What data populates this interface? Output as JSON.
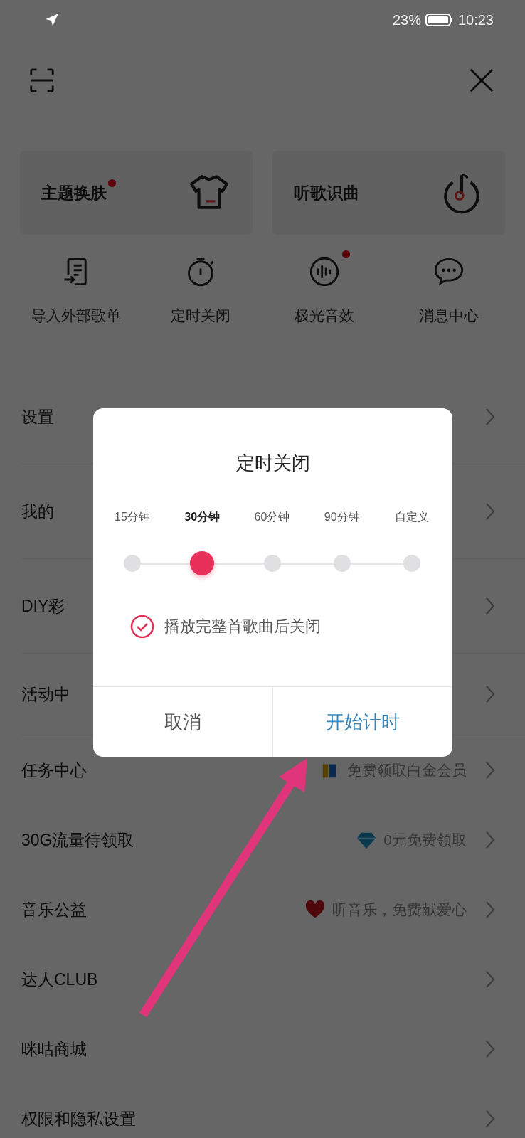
{
  "status_bar": {
    "battery": "23%",
    "time": "10:23"
  },
  "cards": [
    {
      "title": "主题换肤",
      "badge": true,
      "kind": "shirt"
    },
    {
      "title": "听歌识曲",
      "badge": false,
      "kind": "music"
    }
  ],
  "shortcuts": [
    {
      "label": "导入外部歌单",
      "badge": false,
      "kind": "import"
    },
    {
      "label": "定时关闭",
      "badge": false,
      "kind": "timer"
    },
    {
      "label": "极光音效",
      "badge": true,
      "kind": "sound"
    },
    {
      "label": "消息中心",
      "badge": false,
      "kind": "chat"
    }
  ],
  "rows": [
    {
      "label": "设置"
    },
    {
      "label": "我的"
    },
    {
      "label": "DIY彩"
    },
    {
      "label": "活动中"
    },
    {
      "label": "任务中心",
      "value": "免费领取白金会员",
      "kind": "stripe"
    },
    {
      "label": "30G流量待领取",
      "value": "0元免费领取",
      "kind": "diamond"
    },
    {
      "label": "音乐公益",
      "value": "听音乐，免费献爱心",
      "kind": "heart"
    },
    {
      "label": "达人CLUB"
    },
    {
      "label": "咪咕商城"
    },
    {
      "label": "权限和隐私设置"
    }
  ],
  "dialog": {
    "title": "定时关闭",
    "options": [
      {
        "label": "15分钟",
        "selected": false
      },
      {
        "label": "30分钟",
        "selected": true
      },
      {
        "label": "60分钟",
        "selected": false
      },
      {
        "label": "90分钟",
        "selected": false
      },
      {
        "label": "自定义",
        "selected": false
      }
    ],
    "checkbox": {
      "label": "播放完整首歌曲后关闭",
      "checked": true
    },
    "buttons": [
      {
        "label": "取消",
        "kind": "cancel"
      },
      {
        "label": "开始计时",
        "kind": "confirm"
      }
    ]
  }
}
